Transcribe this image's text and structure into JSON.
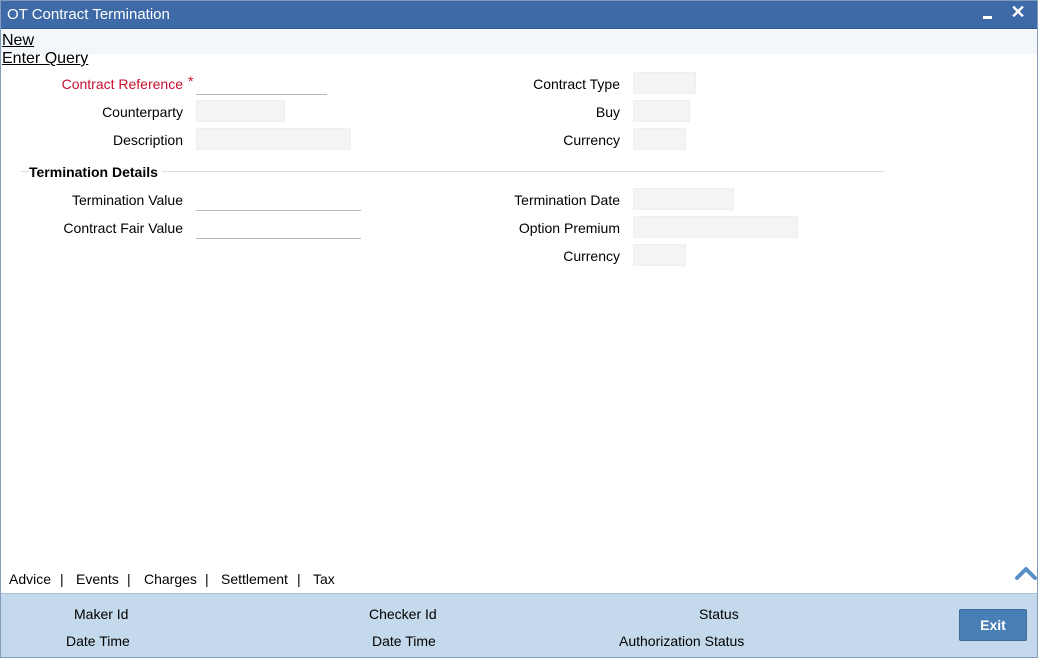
{
  "window": {
    "title": "OT Contract Termination",
    "minimize_label": "",
    "close_label": "✕"
  },
  "menu": {
    "new_label": "New",
    "enter_query_label": "Enter Query"
  },
  "contract": {
    "reference_label": "Contract Reference",
    "required_marker": "*",
    "reference_value": "",
    "counterparty_label": "Counterparty",
    "counterparty_value": "",
    "description_label": "Description",
    "description_value": "",
    "contract_type_label": "Contract Type",
    "contract_type_value": "",
    "buy_label": "Buy",
    "buy_value": "",
    "currency_label": "Currency",
    "currency_value": ""
  },
  "termination": {
    "section_title": "Termination Details",
    "termination_value_label": "Termination Value",
    "termination_value": "",
    "fair_value_label": "Contract Fair Value",
    "fair_value": "",
    "termination_date_label": "Termination Date",
    "termination_date": "",
    "option_premium_label": "Option Premium",
    "option_premium": "",
    "currency_label": "Currency",
    "currency_value": ""
  },
  "tabs": [
    {
      "label": "Advice"
    },
    {
      "label": "Events"
    },
    {
      "label": "Charges"
    },
    {
      "label": "Settlement"
    },
    {
      "label": "Tax"
    }
  ],
  "tab_separator": "|",
  "footer": {
    "maker_id_label": "Maker Id",
    "maker_date_time_label": "Date Time",
    "checker_id_label": "Checker Id",
    "checker_date_time_label": "Date Time",
    "status_label": "Status",
    "authorization_status_label": "Authorization Status",
    "exit_label": "Exit"
  },
  "colors": {
    "titlebar": "#3e6aa8",
    "required": "#c8102e",
    "footer": "#c5d9ec",
    "exit_button": "#4a7fb6"
  }
}
